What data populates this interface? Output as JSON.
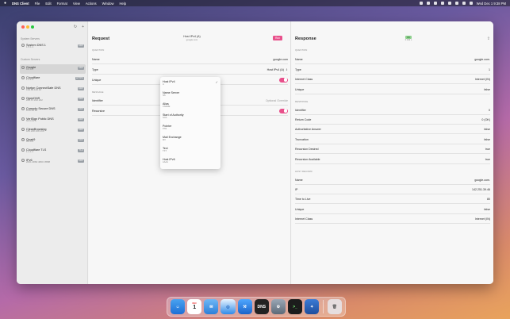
{
  "menubar": {
    "apple": "",
    "items": [
      "DNS Client",
      "File",
      "Edit",
      "Format",
      "View",
      "Actions",
      "Window",
      "Help"
    ],
    "clock": "Wed Dec 1 9:38 PM"
  },
  "window": {
    "title": "DNS Client",
    "server_info": "Server | Google | 8.8.8.8 | UDP"
  },
  "sidebar": {
    "system_section": "System Servers",
    "custom_section": "Custom Servers",
    "system_items": [
      {
        "name": "System DNS 1",
        "sub": "1.1.1.1",
        "badge": "UDP"
      }
    ],
    "custom_items": [
      {
        "name": "Google",
        "sub": "8.8.8.8",
        "badge": "UDP"
      },
      {
        "name": "Cloudflare",
        "sub": "1.1.1.1",
        "badge": "HTTPS"
      },
      {
        "name": "Norton ConnectSafe DNS",
        "sub": "199.85.126.10",
        "badge": "UDP"
      },
      {
        "name": "OpenDNS",
        "sub": "208.67.222.222",
        "badge": "UDP"
      },
      {
        "name": "Comodo Secure DNS",
        "sub": "8.26.56.26",
        "badge": "UDP"
      },
      {
        "name": "VeriSign Public DNS",
        "sub": "64.6.64.6",
        "badge": "UDP"
      },
      {
        "name": "CleanBrowsing",
        "sub": "185.228.168.168",
        "badge": "UDP"
      },
      {
        "name": "Quad9",
        "sub": "9.9.9.9",
        "badge": "UDP"
      },
      {
        "name": "Cloudflare TLS",
        "sub": "1.1.1.1",
        "badge": "TLS"
      },
      {
        "name": "IPv6",
        "sub": "2001:4860:4860::8888",
        "badge": "UDP"
      }
    ]
  },
  "request": {
    "title": "Request",
    "center_title": "Host IPv4 (A)",
    "center_sub": "google.com",
    "run_label": "Run",
    "question_section": "Question",
    "rows": [
      {
        "label": "Name",
        "value": "google.com"
      },
      {
        "label": "Type",
        "value": "Host IPv4 (A)"
      },
      {
        "label": "Unique",
        "value": ""
      }
    ],
    "message_section": "Message",
    "message_rows": [
      {
        "label": "Identifier",
        "value": "Optional Override"
      },
      {
        "label": "Recursive",
        "value": ""
      }
    ]
  },
  "dropdown": {
    "items": [
      {
        "name": "Host IPv4",
        "sub": "A",
        "checked": true
      },
      {
        "name": "Name Server",
        "sub": "NS",
        "checked": false
      },
      {
        "name": "Alias",
        "sub": "CNAME",
        "checked": false
      },
      {
        "name": "Start of Authority",
        "sub": "SOA",
        "checked": false
      },
      {
        "name": "Pointer",
        "sub": "PTR",
        "checked": false
      },
      {
        "name": "Mail Exchange",
        "sub": "MX",
        "checked": false
      },
      {
        "name": "Text",
        "sub": "TXT",
        "checked": false
      },
      {
        "name": "Host IPv6",
        "sub": "AAAA",
        "checked": false
      }
    ],
    "check_glyph": "✓"
  },
  "response": {
    "title": "Response",
    "status_badge": "OK",
    "status_sub": "0.043 s",
    "question_section": "Question",
    "question_rows": [
      {
        "label": "Name",
        "value": "google.com."
      },
      {
        "label": "Type",
        "value": "1"
      },
      {
        "label": "Internet Class",
        "value": "Internet (IN)"
      },
      {
        "label": "Unique",
        "value": "false"
      }
    ],
    "response_section": "Response",
    "response_rows": [
      {
        "label": "Identifier",
        "value": "0"
      },
      {
        "label": "Return Code",
        "value": "0 (OK)"
      },
      {
        "label": "Authoritative Answer",
        "value": "false"
      },
      {
        "label": "Truncation",
        "value": "false"
      },
      {
        "label": "Recursion Desired",
        "value": "true"
      },
      {
        "label": "Recursion Available",
        "value": "true"
      }
    ],
    "host_section": "Host Record",
    "host_rows": [
      {
        "label": "Name",
        "value": "google.com."
      },
      {
        "label": "IP",
        "value": "142.251.39.46"
      },
      {
        "label": "Time to Live",
        "value": "80"
      },
      {
        "label": "Unique",
        "value": "false"
      },
      {
        "label": "Internet Class",
        "value": "Internet (IN)"
      }
    ]
  },
  "dock": {
    "calendar_month": "DEC",
    "calendar_day": "1",
    "dns_label": "DNS"
  }
}
